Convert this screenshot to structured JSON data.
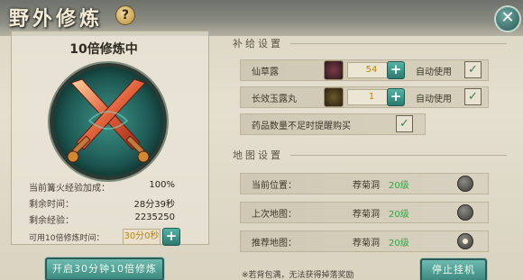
{
  "window": {
    "title": "野外修炼",
    "help_icon": "?"
  },
  "left": {
    "mode_title": "10倍修炼中",
    "stats": [
      {
        "label": "当前篝火经验加成：",
        "value": "100%"
      },
      {
        "label": "剩余时间：",
        "value": "28分39秒"
      },
      {
        "label": "剩余经验：",
        "value": "2235250"
      }
    ],
    "available_label": "可用10倍修炼时间：",
    "available_value": "30分0秒",
    "start_button": "开启30分钟10倍修炼"
  },
  "supply": {
    "section_title": "补给设置",
    "items": [
      {
        "name": "仙草露",
        "qty": "54",
        "auto_label": "自动使用",
        "checked": true,
        "icon": "potion-icon"
      },
      {
        "name": "长效玉露丸",
        "qty": "1",
        "auto_label": "自动使用",
        "checked": true,
        "icon": "pill-icon"
      }
    ],
    "reminder_label": "药品数量不足时提醒购买",
    "reminder_checked": true
  },
  "map": {
    "section_title": "地图设置",
    "rows": [
      {
        "label": "当前位置：",
        "map": "荐菊洞",
        "level": "20级",
        "selected": false
      },
      {
        "label": "上次地图：",
        "map": "荐菊洞",
        "level": "20级",
        "selected": false
      },
      {
        "label": "推荐地图：",
        "map": "荐菊洞",
        "level": "20级",
        "selected": true
      }
    ],
    "note": "※若背包满，无法获得掉落奖励",
    "stop_button": "停止挂机"
  },
  "colors": {
    "accent_green": "#3f8a80",
    "level_green": "#35a34a",
    "value_gold": "#b8860b"
  }
}
